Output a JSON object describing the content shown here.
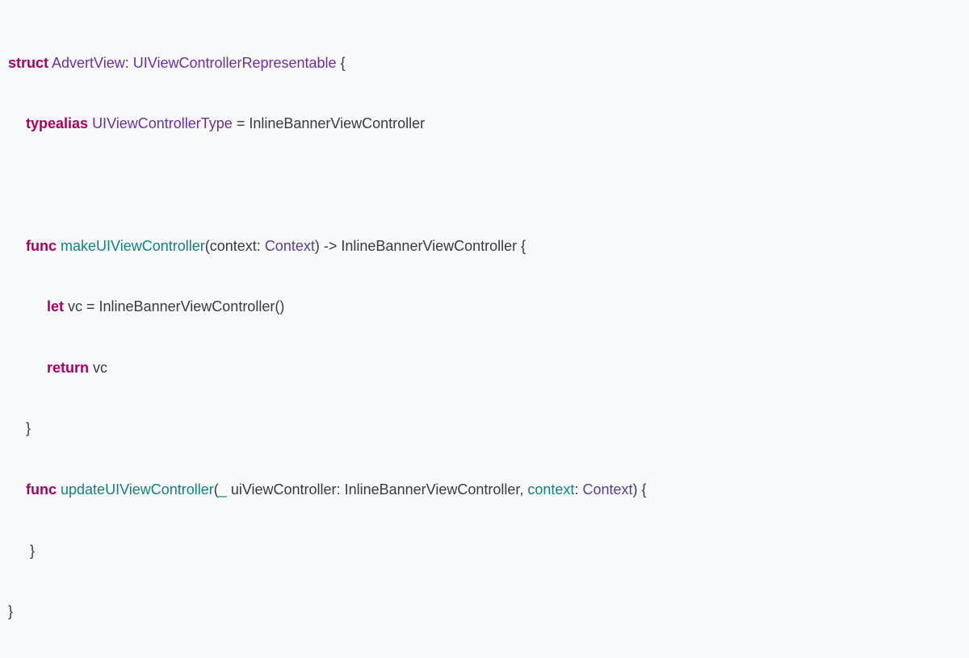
{
  "code": {
    "l1": {
      "kw": "struct",
      "name": "AdvertView",
      "colon": ": ",
      "proto": "UIViewControllerRepresentable",
      "brace": " {"
    },
    "l2": {
      "kw": "typealias",
      "name": "UIViewControllerType",
      "eq": " = ",
      "type": "InlineBannerViewController"
    },
    "l3": {
      "kw": "func",
      "name": "makeUIViewController",
      "open": "(",
      "label": "context",
      "colon": ": ",
      "ptype": "Context",
      "close": ") ",
      "arrow": "->",
      "ret": " InlineBannerViewController ",
      "brace": "{"
    },
    "l4": {
      "kw": "let",
      "text": " vc = InlineBannerViewController()"
    },
    "l5": {
      "kw": "return",
      "text": " vc"
    },
    "l6": {
      "brace": "}"
    },
    "l7": {
      "kw": "func",
      "name": "updateUIViewController",
      "open": "(",
      "under": "_",
      "label": " uiViewController",
      "colon": ": ",
      "ptype": "InlineBannerViewController",
      "comma": ", ",
      "label2": "context",
      "colon2": ": ",
      "ptype2": "Context",
      "close": ") ",
      "brace": "{"
    },
    "l8": {
      "brace": "}"
    },
    "l9": {
      "brace": "}"
    }
  }
}
